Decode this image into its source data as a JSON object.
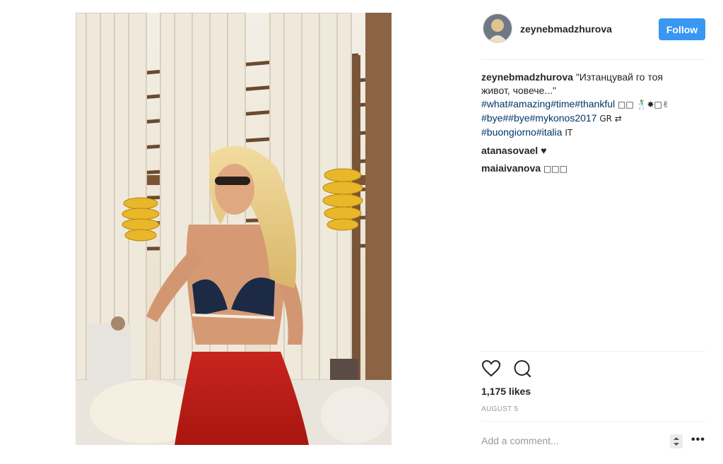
{
  "post": {
    "username": "zeynebmadzhurova",
    "follow_label": "Follow",
    "caption": {
      "user": "zeynebmadzhurova",
      "text_line1": "\"Изтанцувай го тоя",
      "text_line2": "живот, човече...\"",
      "line3_tags": [
        "#what",
        "#amazing",
        "#time",
        "#thankful"
      ],
      "line3_emoji": "□□ 🕺✸□✌",
      "line4_tags": [
        "#bye",
        "#",
        "#bye",
        "#mykonos2017"
      ],
      "line4_emoji": "GR ⇄",
      "line5_tags": [
        "#buongiorno",
        "#italia"
      ],
      "line5_emoji": "IT"
    },
    "comments": [
      {
        "user": "atanasovael",
        "text": "♥"
      },
      {
        "user": "maiaivanova",
        "text": "□□□"
      }
    ],
    "likes_text": "1,175 likes",
    "date_text": "AUGUST 5",
    "add_comment_placeholder": "Add a comment...",
    "more_label": "•••"
  },
  "colors": {
    "accent": "#3897f0",
    "hashtag": "#003569",
    "muted": "#999999",
    "divider": "#efefef"
  },
  "icons": {
    "like": "heart-icon",
    "comment": "comment-bubble-icon",
    "options": "more-options-icon"
  }
}
